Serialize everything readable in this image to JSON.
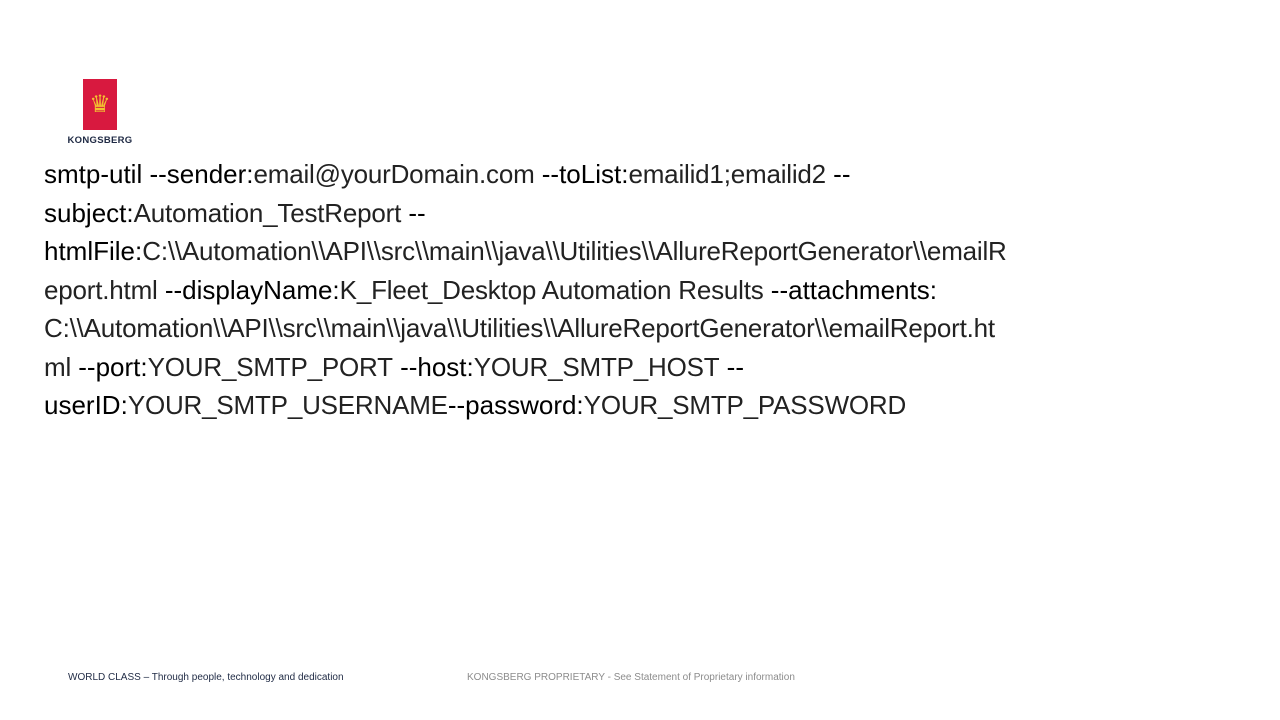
{
  "logo": {
    "wordmark": "KONGSBERG"
  },
  "lines": [
    [
      {
        "t": "k",
        "s": "smtp-util --sender:"
      },
      {
        "t": "v",
        "s": "email@yourDomain.com"
      },
      {
        "t": "k",
        "s": " --toList:"
      },
      {
        "t": "v",
        "s": "emailid1;emailid2"
      },
      {
        "t": "k",
        "s": " --"
      }
    ],
    [
      {
        "t": "k",
        "s": "subject:"
      },
      {
        "t": "v",
        "s": "Automation_TestReport"
      },
      {
        "t": "k",
        "s": " --"
      }
    ],
    [
      {
        "t": "k",
        "s": "htmlFile:"
      },
      {
        "t": "v",
        "s": "C:\\\\Automation\\\\API\\\\src\\\\main\\\\java\\\\Utilities\\\\AllureReportGenerator\\\\emailR"
      }
    ],
    [
      {
        "t": "v",
        "s": "eport.html"
      },
      {
        "t": "k",
        "s": " --displayName:"
      },
      {
        "t": "v",
        "s": "K_Fleet_Desktop Automation Results"
      },
      {
        "t": "k",
        "s": " --attachments:"
      }
    ],
    [
      {
        "t": "v",
        "s": "C:\\\\Automation\\\\API\\\\src\\\\main\\\\java\\\\Utilities\\\\AllureReportGenerator\\\\emailReport.ht"
      }
    ],
    [
      {
        "t": "v",
        "s": "ml"
      },
      {
        "t": "k",
        "s": " --port:"
      },
      {
        "t": "v",
        "s": "YOUR_SMTP_PORT"
      },
      {
        "t": "k",
        "s": " --host:"
      },
      {
        "t": "v",
        "s": "YOUR_SMTP_HOST"
      },
      {
        "t": "k",
        "s": " --"
      }
    ],
    [
      {
        "t": "k",
        "s": "userID:"
      },
      {
        "t": "v",
        "s": "YOUR_SMTP_USERNAME"
      },
      {
        "t": "k",
        "s": "--password:"
      },
      {
        "t": "v",
        "s": "YOUR_SMTP_PASSWORD"
      }
    ]
  ],
  "footer": {
    "left": "WORLD CLASS  –  Through people, technology and dedication",
    "right": "KONGSBERG PROPRIETARY  - See Statement of Proprietary information"
  }
}
